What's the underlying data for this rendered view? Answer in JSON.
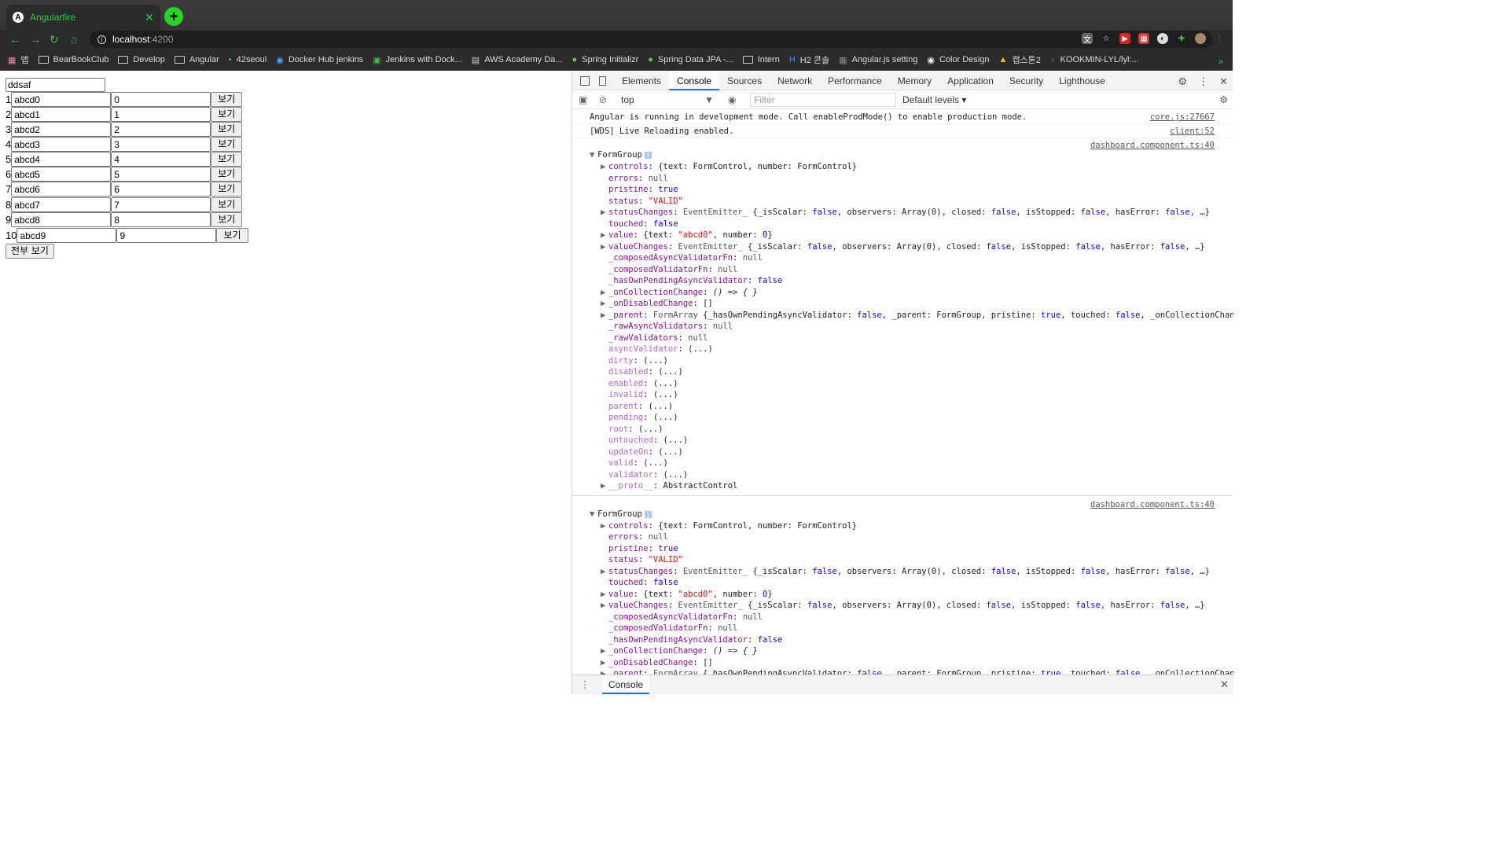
{
  "browser": {
    "tab_title": "Angularfire",
    "url_host": "localhost",
    "url_port": ":4200",
    "bookmarks": [
      "앱",
      "BearBookClub",
      "Develop",
      "Angular",
      "42seoul",
      "Docker Hub jenkins",
      "Jenkins with Dock...",
      "AWS Academy Da...",
      "Spring Initializr",
      "Spring Data JPA -...",
      "Intern",
      "H2 콘솔",
      "Angular.js setting",
      "Color Design",
      "캡스톤2",
      "KOOKMIN-LYL/lyl:..."
    ]
  },
  "page": {
    "top_input_value": "ddsaf",
    "rows": [
      {
        "num": "1",
        "text": "abcd0",
        "number": "0",
        "button": "보기"
      },
      {
        "num": "2",
        "text": "abcd1",
        "number": "1",
        "button": "보기"
      },
      {
        "num": "3",
        "text": "abcd2",
        "number": "2",
        "button": "보기"
      },
      {
        "num": "4",
        "text": "abcd3",
        "number": "3",
        "button": "보기"
      },
      {
        "num": "5",
        "text": "abcd4",
        "number": "4",
        "button": "보기"
      },
      {
        "num": "6",
        "text": "abcd5",
        "number": "5",
        "button": "보기"
      },
      {
        "num": "7",
        "text": "abcd6",
        "number": "6",
        "button": "보기"
      },
      {
        "num": "8",
        "text": "abcd7",
        "number": "7",
        "button": "보기"
      },
      {
        "num": "9",
        "text": "abcd8",
        "number": "8",
        "button": "보기"
      },
      {
        "num": "10",
        "text": "abcd9",
        "number": "9",
        "button": "보기"
      }
    ],
    "all_button": "전부 보기"
  },
  "devtools": {
    "tabs": [
      "Elements",
      "Console",
      "Sources",
      "Network",
      "Performance",
      "Memory",
      "Application",
      "Security",
      "Lighthouse"
    ],
    "active_tab": "Console",
    "context": "top",
    "filter_placeholder": "Filter",
    "levels": "Default levels ▾",
    "messages": [
      {
        "text": "Angular is running in development mode. Call enableProdMode() to enable production mode.",
        "source": "core.js:27667"
      },
      {
        "text": "[WDS] Live Reloading enabled.",
        "source": "client:52"
      }
    ],
    "log_source": "dashboard.component.ts:40",
    "object_name": "FormGroup",
    "drawer_tab": "Console"
  }
}
